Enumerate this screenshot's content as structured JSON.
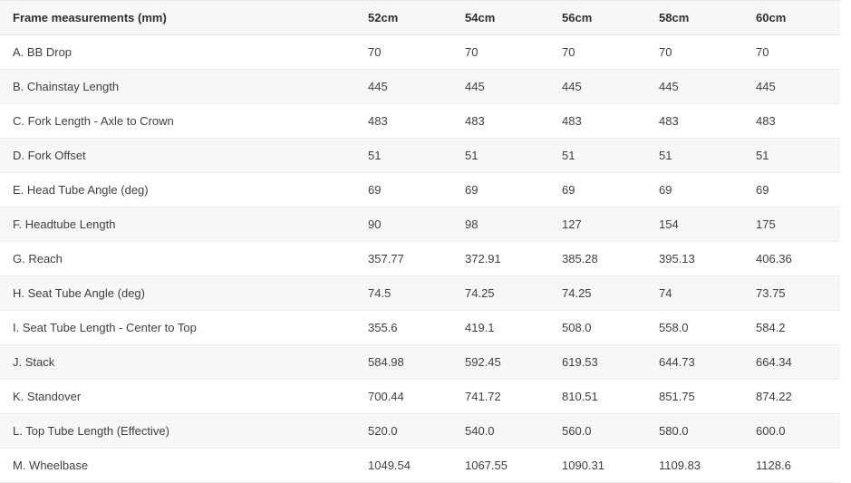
{
  "table": {
    "title_column_header": "Frame measurements (mm)",
    "size_headers": [
      "52cm",
      "54cm",
      "56cm",
      "58cm",
      "60cm"
    ],
    "rows": [
      {
        "label": "A. BB Drop",
        "values": [
          "70",
          "70",
          "70",
          "70",
          "70"
        ]
      },
      {
        "label": "B. Chainstay Length",
        "values": [
          "445",
          "445",
          "445",
          "445",
          "445"
        ]
      },
      {
        "label": "C. Fork Length - Axle to Crown",
        "values": [
          "483",
          "483",
          "483",
          "483",
          "483"
        ]
      },
      {
        "label": "D. Fork Offset",
        "values": [
          "51",
          "51",
          "51",
          "51",
          "51"
        ]
      },
      {
        "label": "E. Head Tube Angle (deg)",
        "values": [
          "69",
          "69",
          "69",
          "69",
          "69"
        ]
      },
      {
        "label": "F. Headtube Length",
        "values": [
          "90",
          "98",
          "127",
          "154",
          "175"
        ]
      },
      {
        "label": "G. Reach",
        "values": [
          "357.77",
          "372.91",
          "385.28",
          "395.13",
          "406.36"
        ]
      },
      {
        "label": "H. Seat Tube Angle (deg)",
        "values": [
          "74.5",
          "74.25",
          "74.25",
          "74",
          "73.75"
        ]
      },
      {
        "label": "I. Seat Tube Length - Center to Top",
        "values": [
          "355.6",
          "419.1",
          "508.0",
          "558.0",
          "584.2"
        ]
      },
      {
        "label": "J. Stack",
        "values": [
          "584.98",
          "592.45",
          "619.53",
          "644.73",
          "664.34"
        ]
      },
      {
        "label": "K. Standover",
        "values": [
          "700.44",
          "741.72",
          "810.51",
          "851.75",
          "874.22"
        ]
      },
      {
        "label": "L. Top Tube Length (Effective)",
        "values": [
          "520.0",
          "540.0",
          "560.0",
          "580.0",
          "600.0"
        ]
      },
      {
        "label": "M. Wheelbase",
        "values": [
          "1049.54",
          "1067.55",
          "1090.31",
          "1109.83",
          "1128.6"
        ]
      }
    ]
  },
  "colors": {
    "header_background": "#f7f7f7",
    "row_alt_background": "#f7f7f7",
    "row_background": "#ffffff",
    "row_border": "#ececec",
    "text": "#3f3f3f",
    "header_text": "#2f2f2f"
  }
}
